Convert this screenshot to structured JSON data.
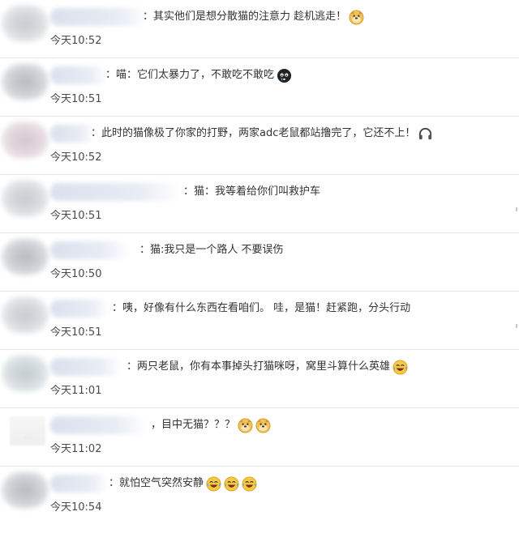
{
  "comments": [
    {
      "text": "：其实他们是想分散猫的注意力 趁机逃走！",
      "time": "今天10:52",
      "emojis": [
        "doge-icon"
      ]
    },
    {
      "text": "：喵：它们太暴力了，不敢吃不敢吃",
      "time": "今天10:51",
      "emojis": [
        "crying-face-icon"
      ]
    },
    {
      "text": "：此时的猫像极了你家的打野，两家adc老鼠都站撸完了，它还不上！",
      "time": "今天10:52",
      "emojis": [
        "headphones-icon"
      ]
    },
    {
      "text": "：猫：我等着给你们叫救护车",
      "time": "今天10:51",
      "emojis": [
        "doge-icon"
      ]
    },
    {
      "text": "：猫:我只是一个路人 不要误伤",
      "time": "今天10:50",
      "emojis": []
    },
    {
      "text": "：咦，好像有什么东西在看咱们。 哇，是猫！赶紧跑，分头行动",
      "time": "今天10:51",
      "emojis": []
    },
    {
      "text": "：两只老鼠，你有本事掉头打猫咪呀，窝里斗算什么英雄",
      "time": "今天11:01",
      "emojis": [
        "laughing-tears-icon"
      ]
    },
    {
      "text": "，目中无猫？？？",
      "time": "今天11:02",
      "emojis": [
        "doge-icon",
        "doge-icon"
      ]
    },
    {
      "text": "：就怕空气突然安静",
      "time": "今天10:54",
      "emojis": [
        "laughing-tears-icon",
        "laughing-tears-icon",
        "laughing-tears-icon"
      ]
    }
  ],
  "colors": {
    "divider": "#e6e6e6",
    "text": "#333333",
    "time": "#4a4a4a"
  }
}
